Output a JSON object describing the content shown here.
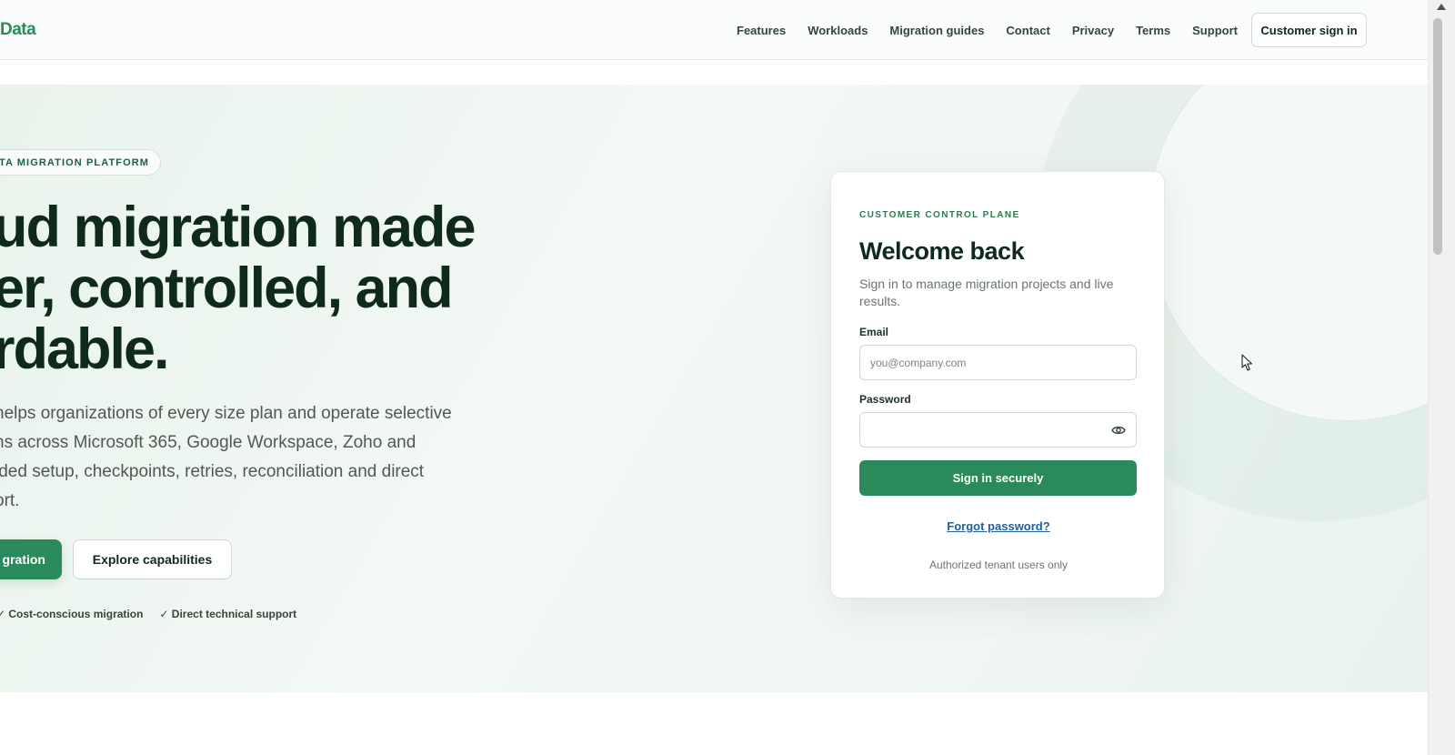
{
  "header": {
    "brand": "Data",
    "nav": [
      "Features",
      "Workloads",
      "Migration guides",
      "Contact",
      "Privacy",
      "Terms",
      "Support"
    ],
    "signin_label": "Customer sign in"
  },
  "hero": {
    "eyebrow": "TA MIGRATION PLATFORM",
    "headline": [
      "ud migration made",
      "er, controlled, and",
      "rdable."
    ],
    "lede": [
      " helps organizations of every size plan and operate selective",
      "ns across Microsoft 365, Google Workspace, Zoho and",
      "ided setup, checkpoints, retries, reconciliation and direct",
      "ort."
    ],
    "primary_button": "gration",
    "secondary_button": "Explore capabilities",
    "checks": [
      "✓ Cost-conscious migration",
      "✓ Direct technical support"
    ]
  },
  "login": {
    "eyebrow": "CUSTOMER CONTROL PLANE",
    "title": "Welcome back",
    "subtitle": "Sign in to manage migration projects and live results.",
    "email_label": "Email",
    "email_placeholder": "you@company.com",
    "password_label": "Password",
    "password_value": "",
    "submit_label": "Sign in securely",
    "forgot_label": "Forgot password?",
    "footer_note": "Authorized tenant users only"
  },
  "colors": {
    "brand_green": "#2b8a5c",
    "heading": "#0f2a1c",
    "link_blue": "#1f5fa0"
  },
  "icons": {
    "password_toggle": "eye-icon",
    "pointer": "mouse-cursor-icon",
    "scroll": "scroll-up-arrow-icon"
  }
}
